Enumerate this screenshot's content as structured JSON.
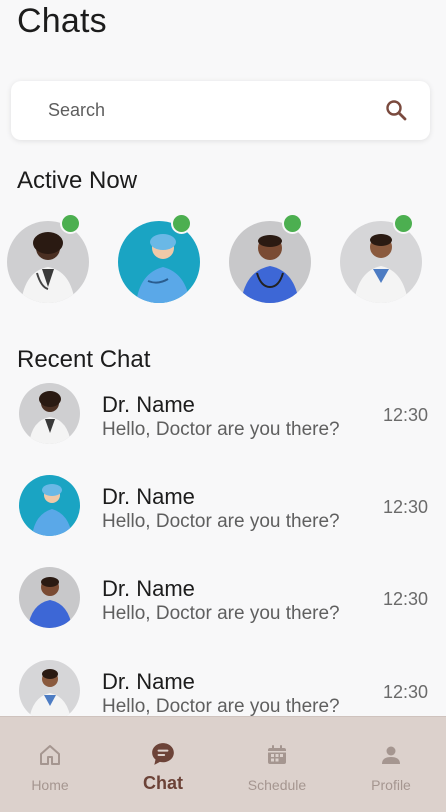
{
  "header": {
    "title": "Chats"
  },
  "search": {
    "placeholder": "Search",
    "icon": "search-icon"
  },
  "active_now": {
    "title": "Active Now",
    "status_color": "#4caf50",
    "doctors": [
      {
        "avatar": "doctor-avatar-1",
        "online": true
      },
      {
        "avatar": "doctor-avatar-2",
        "online": true
      },
      {
        "avatar": "doctor-avatar-3",
        "online": true
      },
      {
        "avatar": "doctor-avatar-4",
        "online": true
      }
    ]
  },
  "recent_chat": {
    "title": "Recent Chat",
    "items": [
      {
        "name": "Dr. Name",
        "message": "Hello, Doctor are you there?",
        "time": "12:30"
      },
      {
        "name": "Dr. Name",
        "message": "Hello, Doctor are you there?",
        "time": "12:30"
      },
      {
        "name": "Dr. Name",
        "message": "Hello, Doctor are you there?",
        "time": "12:30"
      },
      {
        "name": "Dr. Name",
        "message": "Hello, Doctor are you there?",
        "time": "12:30"
      }
    ]
  },
  "bottom_nav": {
    "items": [
      {
        "label": "Home",
        "icon": "home-icon",
        "active": false
      },
      {
        "label": "Chat",
        "icon": "chat-icon",
        "active": true
      },
      {
        "label": "Schedule",
        "icon": "calendar-icon",
        "active": false
      },
      {
        "label": "Profile",
        "icon": "person-icon",
        "active": false
      }
    ],
    "active_color": "#6c4338",
    "inactive_color": "#a59690",
    "background": "#dcd1cc"
  }
}
